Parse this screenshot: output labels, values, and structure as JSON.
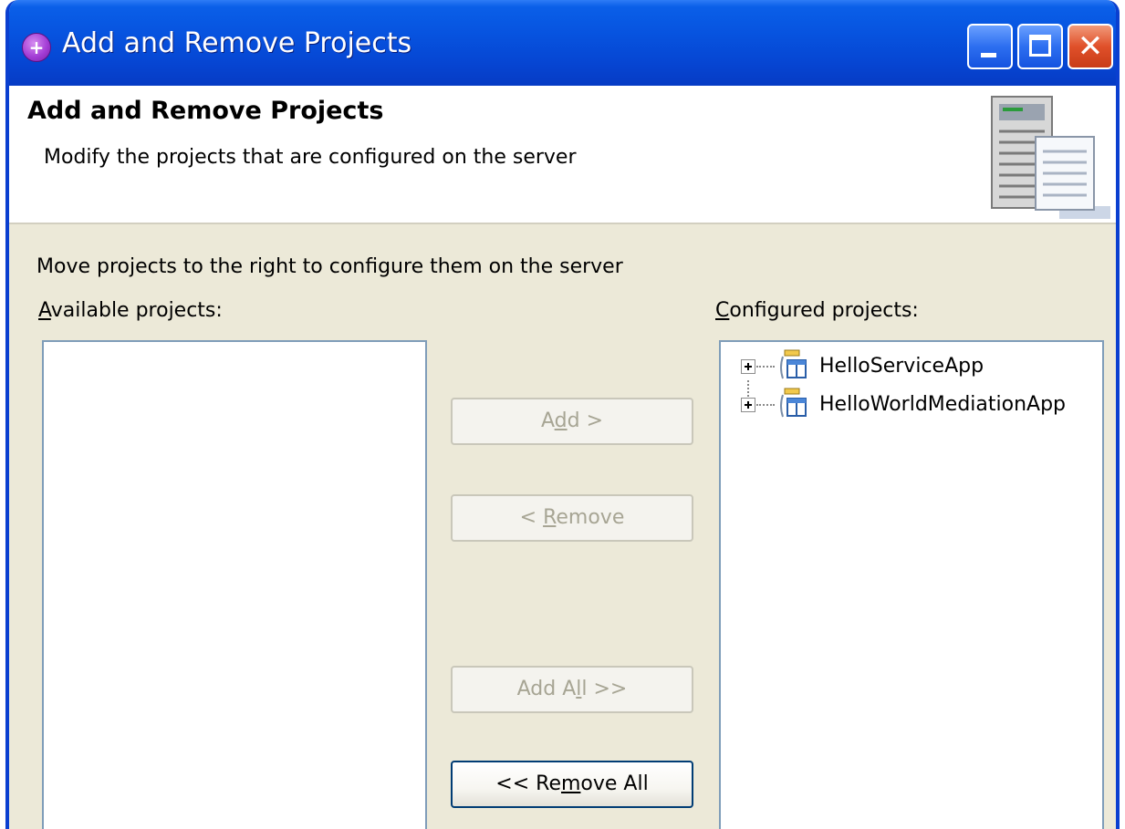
{
  "window": {
    "title": "Add and Remove Projects"
  },
  "banner": {
    "title": "Add and Remove Projects",
    "subtitle": "Modify the projects that are configured on the server"
  },
  "instructions": "Move projects to the right to configure them on the server",
  "available": {
    "label_mnemonic": "A",
    "label_rest": "vailable projects:",
    "items": []
  },
  "configured": {
    "label_mnemonic": "C",
    "label_rest": "onfigured projects:",
    "items": [
      {
        "label": "HelloServiceApp"
      },
      {
        "label": "HelloWorldMediationApp"
      }
    ]
  },
  "buttons": {
    "add": {
      "pre": "A",
      "mnemonic": "d",
      "post": "d >",
      "enabled": false
    },
    "remove": {
      "pre": "< ",
      "mnemonic": "R",
      "post": "emove",
      "enabled": false
    },
    "add_all": {
      "pre": "Add A",
      "mnemonic": "l",
      "post": "l >>",
      "enabled": false
    },
    "remove_all": {
      "pre": "<< Re",
      "mnemonic": "m",
      "post": "ove All",
      "enabled": true
    }
  },
  "colors": {
    "title_bar": "#0753df",
    "dialog_bg": "#ece9d8",
    "list_border": "#7f9db9"
  },
  "icons": {
    "app": "eclipse-app-icon",
    "minimize": "minimize-icon",
    "maximize": "maximize-icon",
    "close": "close-icon",
    "banner": "server-icon",
    "tree_expand": "plus-icon",
    "project": "enterprise-app-project-icon"
  }
}
